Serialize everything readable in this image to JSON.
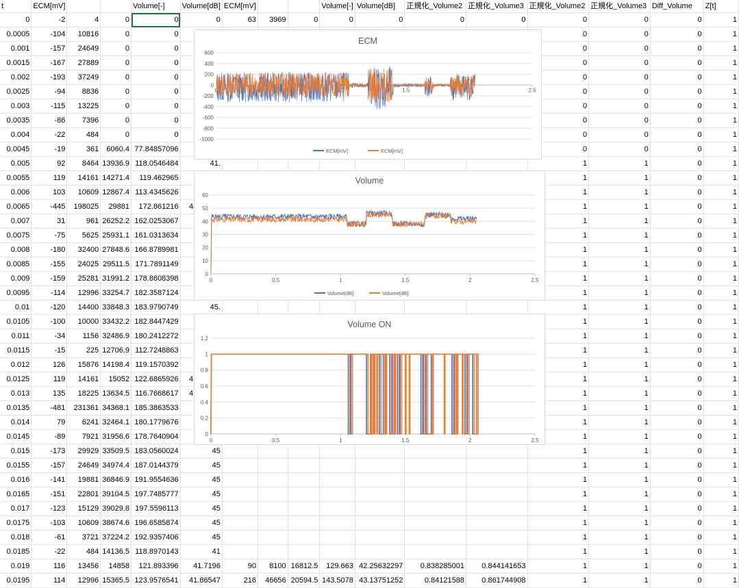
{
  "sheet": {
    "headers": [
      "t",
      "ECM[mV]",
      "",
      "",
      "Volume[-]",
      "Volume[dB]",
      "ECM[mV]",
      "",
      "",
      "Volume[-]",
      "Volume[dB]",
      "正規化_Volume2",
      "正規化_Volume3",
      "正規化_Volume2",
      "正規化_Volume3",
      "Diff_Volume",
      "Z[t]"
    ],
    "rows": [
      [
        "0",
        "-2",
        "4",
        "0",
        "0",
        "0",
        "63",
        "3969",
        "0",
        "0",
        "0",
        "0",
        "0",
        "0",
        "0",
        "0",
        "1"
      ],
      [
        "0.0005",
        "-104",
        "10816",
        "0",
        "0",
        "0",
        "-110",
        "12100",
        "0",
        "0",
        "0",
        "0",
        "0",
        "0",
        "0",
        "0",
        "1"
      ],
      [
        "0.001",
        "-157",
        "24649",
        "0",
        "0",
        "",
        "",
        "",
        "",
        "",
        "",
        "",
        "",
        "0",
        "0",
        "0",
        "1"
      ],
      [
        "0.0015",
        "-167",
        "27889",
        "0",
        "0",
        "",
        "",
        "",
        "",
        "",
        "",
        "",
        "",
        "0",
        "0",
        "0",
        "1"
      ],
      [
        "0.002",
        "-193",
        "37249",
        "0",
        "0",
        "",
        "",
        "",
        "",
        "",
        "",
        "",
        "",
        "0",
        "0",
        "0",
        "1"
      ],
      [
        "0.0025",
        "-94",
        "8836",
        "0",
        "0",
        "",
        "",
        "",
        "",
        "",
        "",
        "",
        "",
        "0",
        "0",
        "0",
        "1"
      ],
      [
        "0.003",
        "-115",
        "13225",
        "0",
        "0",
        "",
        "",
        "",
        "",
        "",
        "",
        "",
        "",
        "0",
        "0",
        "0",
        "1"
      ],
      [
        "0.0035",
        "-86",
        "7396",
        "0",
        "0",
        "",
        "",
        "",
        "",
        "",
        "",
        "",
        "",
        "0",
        "0",
        "0",
        "1"
      ],
      [
        "0.004",
        "-22",
        "484",
        "0",
        "0",
        "",
        "",
        "",
        "",
        "",
        "",
        "",
        "",
        "0",
        "0",
        "0",
        "1"
      ],
      [
        "0.0045",
        "-19",
        "361",
        "6060.4",
        "77.84857096",
        "37.",
        "",
        "",
        "",
        "",
        "",
        "",
        "",
        "0",
        "0",
        "0",
        "1"
      ],
      [
        "0.005",
        "92",
        "8464",
        "13936.9",
        "118.0546484",
        "41.",
        "",
        "",
        "",
        "",
        "",
        "",
        "",
        "1",
        "1",
        "0",
        "1"
      ],
      [
        "0.0055",
        "119",
        "14161",
        "14271.4",
        "119.462965",
        "41.",
        "",
        "",
        "",
        "",
        "",
        "",
        "",
        "1",
        "1",
        "0",
        "1"
      ],
      [
        "0.006",
        "103",
        "10609",
        "12867.4",
        "113.4345626",
        "41.",
        "",
        "",
        "",
        "",
        "",
        "",
        "",
        "1",
        "1",
        "0",
        "1"
      ],
      [
        "0.0065",
        "-445",
        "198025",
        "29881",
        "172.861216",
        "44.75395",
        "-513",
        "263169",
        "40212.5",
        "200.5305",
        "46.04361074",
        "0.899255096",
        "0.919799144",
        "1",
        "1",
        "0",
        "1"
      ],
      [
        "0.007",
        "31",
        "961",
        "26252.2",
        "162.0253067",
        "44.",
        "",
        "",
        "",
        "",
        "",
        "",
        "",
        "1",
        "1",
        "0",
        "1"
      ],
      [
        "0.0075",
        "-75",
        "5625",
        "25931.1",
        "161.0313634",
        "44.",
        "",
        "",
        "",
        "",
        "",
        "",
        "",
        "1",
        "1",
        "0",
        "1"
      ],
      [
        "0.008",
        "-180",
        "32400",
        "27848.6",
        "166.8789981",
        "44.",
        "",
        "",
        "",
        "",
        "",
        "",
        "",
        "1",
        "1",
        "0",
        "1"
      ],
      [
        "0.0085",
        "-155",
        "24025",
        "29511.5",
        "171.7891149",
        "44.",
        "",
        "",
        "",
        "",
        "",
        "",
        "",
        "1",
        "1",
        "0",
        "1"
      ],
      [
        "0.009",
        "-159",
        "25281",
        "31991.2",
        "178.8608398",
        "45.",
        "",
        "",
        "",
        "",
        "",
        "",
        "",
        "1",
        "1",
        "0",
        "1"
      ],
      [
        "0.0095",
        "-114",
        "12996",
        "33254.7",
        "182.3587124",
        "45.",
        "",
        "",
        "",
        "",
        "",
        "",
        "",
        "1",
        "1",
        "0",
        "1"
      ],
      [
        "0.01",
        "-120",
        "14400",
        "33848.3",
        "183.9790749",
        "45.",
        "",
        "",
        "",
        "",
        "",
        "",
        "",
        "1",
        "1",
        "0",
        "1"
      ],
      [
        "0.0105",
        "-100",
        "10000",
        "33432.2",
        "182.8447429",
        "45.",
        "",
        "",
        "",
        "",
        "",
        "",
        "",
        "1",
        "1",
        "0",
        "1"
      ],
      [
        "0.011",
        "-34",
        "1156",
        "32486.9",
        "180.2412272",
        "45.",
        "",
        "",
        "",
        "",
        "",
        "",
        "",
        "1",
        "1",
        "0",
        "1"
      ],
      [
        "0.0115",
        "-15",
        "225",
        "12706.9",
        "112.7248863",
        "41",
        "",
        "",
        "",
        "",
        "",
        "",
        "",
        "1",
        "1",
        "0",
        "1"
      ],
      [
        "0.012",
        "126",
        "15876",
        "14198.4",
        "119.1570392",
        "41.",
        "",
        "",
        "",
        "",
        "",
        "",
        "",
        "1",
        "1",
        "0",
        "1"
      ],
      [
        "0.0125",
        "119",
        "14161",
        "15052",
        "122.6865926",
        "41.77394",
        "164",
        "33856",
        "17045.4",
        "130.558",
        "42.31007197",
        "0.839417029",
        "0.843555241",
        "1",
        "1",
        "0",
        "1"
      ],
      [
        "0.013",
        "135",
        "18225",
        "13634.5",
        "116.7668617",
        "41.31639",
        "99",
        "9801",
        "14433.7",
        "120.1403",
        "41.59377574",
        "0.830795048",
        "0.83009617",
        "1",
        "1",
        "0",
        "1"
      ],
      [
        "0.0135",
        "-481",
        "231361",
        "34368.1",
        "185.3863533",
        "45",
        "",
        "",
        "",
        "",
        "",
        "",
        "",
        "1",
        "1",
        "0",
        "1"
      ],
      [
        "0.014",
        "79",
        "6241",
        "32464.1",
        "180.1779676",
        "45",
        "",
        "",
        "",
        "",
        "",
        "",
        "",
        "1",
        "1",
        "0",
        "1"
      ],
      [
        "0.0145",
        "-89",
        "7921",
        "31956.6",
        "178.7640904",
        "45",
        "",
        "",
        "",
        "",
        "",
        "",
        "",
        "1",
        "1",
        "0",
        "1"
      ],
      [
        "0.015",
        "-173",
        "29929",
        "33509.5",
        "183.0560024",
        "45",
        "",
        "",
        "",
        "",
        "",
        "",
        "",
        "1",
        "1",
        "0",
        "1"
      ],
      [
        "0.0155",
        "-157",
        "24649",
        "34974.4",
        "187.0144379",
        "45",
        "",
        "",
        "",
        "",
        "",
        "",
        "",
        "1",
        "1",
        "0",
        "1"
      ],
      [
        "0.016",
        "-141",
        "19881",
        "36846.9",
        "191.9554636",
        "45",
        "",
        "",
        "",
        "",
        "",
        "",
        "",
        "1",
        "1",
        "0",
        "1"
      ],
      [
        "0.0165",
        "-151",
        "22801",
        "39104.5",
        "197.7485777",
        "45",
        "",
        "",
        "",
        "",
        "",
        "",
        "",
        "1",
        "1",
        "0",
        "1"
      ],
      [
        "0.017",
        "-123",
        "15129",
        "39029.8",
        "197.5596113",
        "45",
        "",
        "",
        "",
        "",
        "",
        "",
        "",
        "1",
        "1",
        "0",
        "1"
      ],
      [
        "0.0175",
        "-103",
        "10609",
        "38674.6",
        "196.6585874",
        "45",
        "",
        "",
        "",
        "",
        "",
        "",
        "",
        "1",
        "1",
        "0",
        "1"
      ],
      [
        "0.018",
        "-61",
        "3721",
        "37224.2",
        "192.9357406",
        "45",
        "",
        "",
        "",
        "",
        "",
        "",
        "",
        "1",
        "1",
        "0",
        "1"
      ],
      [
        "0.0185",
        "-22",
        "484",
        "14136.5",
        "118.8970143",
        "41",
        "",
        "",
        "",
        "",
        "",
        "",
        "",
        "1",
        "1",
        "0",
        "1"
      ],
      [
        "0.019",
        "116",
        "13456",
        "14858",
        "121.893396",
        "41.7196",
        "90",
        "8100",
        "16812.5",
        "129.663",
        "42.25632297",
        "0.838285001",
        "0.844141653",
        "1",
        "1",
        "0",
        "1"
      ],
      [
        "0.0195",
        "114",
        "12996",
        "15365.5",
        "123.9576541",
        "41.86547",
        "216",
        "46656",
        "20594.5",
        "143.5078",
        "43.13751252",
        "0.84121588",
        "0.861744908",
        "1",
        "1",
        "0",
        "1"
      ]
    ]
  },
  "charts": {
    "ecm": {
      "title": "ECM",
      "type": "line",
      "xlim": [
        0,
        2.5
      ],
      "ylim": [
        -1000,
        600
      ],
      "x_ticks": [
        "0",
        "0.5",
        "1",
        "1.5",
        "2",
        "2.5"
      ],
      "y_ticks": [
        "600",
        "400",
        "200",
        "0",
        "-200",
        "-400",
        "-600",
        "-800",
        "-1000"
      ],
      "series": [
        {
          "name": "ECM[mV]",
          "color": "#4472C4"
        },
        {
          "name": "ECM[mV]",
          "color": "#ED7D31"
        }
      ],
      "legend": "bottom"
    },
    "volume": {
      "title": "Volume",
      "type": "line",
      "xlim": [
        0,
        2.5
      ],
      "ylim": [
        0,
        60
      ],
      "x_ticks": [
        "0",
        "0.5",
        "1",
        "1.5",
        "2",
        "2.5"
      ],
      "y_ticks": [
        "60",
        "50",
        "40",
        "30",
        "20",
        "10",
        "0"
      ],
      "series": [
        {
          "name": "Volume[dB]",
          "color": "#4472C4"
        },
        {
          "name": "Volume[dB]",
          "color": "#ED7D31"
        }
      ],
      "legend": "bottom"
    },
    "volume_on": {
      "title": "Volume ON",
      "type": "line",
      "xlim": [
        0,
        2.5
      ],
      "ylim": [
        0,
        1.2
      ],
      "x_ticks": [
        "0",
        "0.5",
        "1",
        "1.5",
        "2",
        "2.5"
      ],
      "y_ticks": [
        "1.2",
        "1",
        "0.8",
        "0.6",
        "0.4",
        "0.2",
        "0"
      ],
      "series": [
        {
          "name": "",
          "color": "#4472C4"
        },
        {
          "name": "",
          "color": "#ED7D31"
        }
      ]
    }
  }
}
